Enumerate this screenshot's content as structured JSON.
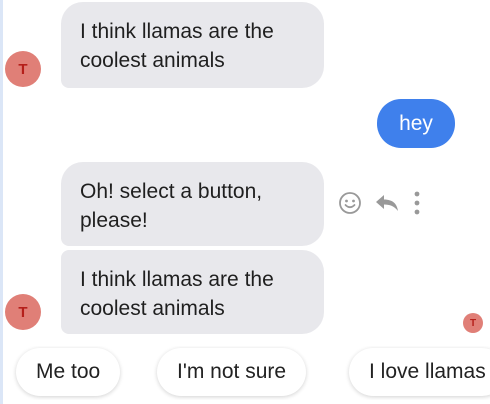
{
  "colors": {
    "incoming_bubble": "#e8e8ec",
    "outgoing_bubble": "#3f80ec",
    "avatar_bg": "#e07f77",
    "avatar_text": "#b51f1a"
  },
  "avatar": {
    "initial": "T"
  },
  "messages": [
    {
      "sender": "bot",
      "text": "I think llamas are the coolest animals"
    },
    {
      "sender": "user",
      "text": "hey"
    },
    {
      "sender": "bot",
      "text": "Oh! select a button, please!"
    },
    {
      "sender": "bot",
      "text": "I think llamas are the coolest animals"
    }
  ],
  "message_actions": [
    "smiley-icon",
    "reply-icon",
    "more-options-icon"
  ],
  "typing_indicator": {
    "initial": "T"
  },
  "quick_replies": [
    {
      "label": "Me too"
    },
    {
      "label": "I'm not sure"
    },
    {
      "label": "I love llamas"
    }
  ]
}
